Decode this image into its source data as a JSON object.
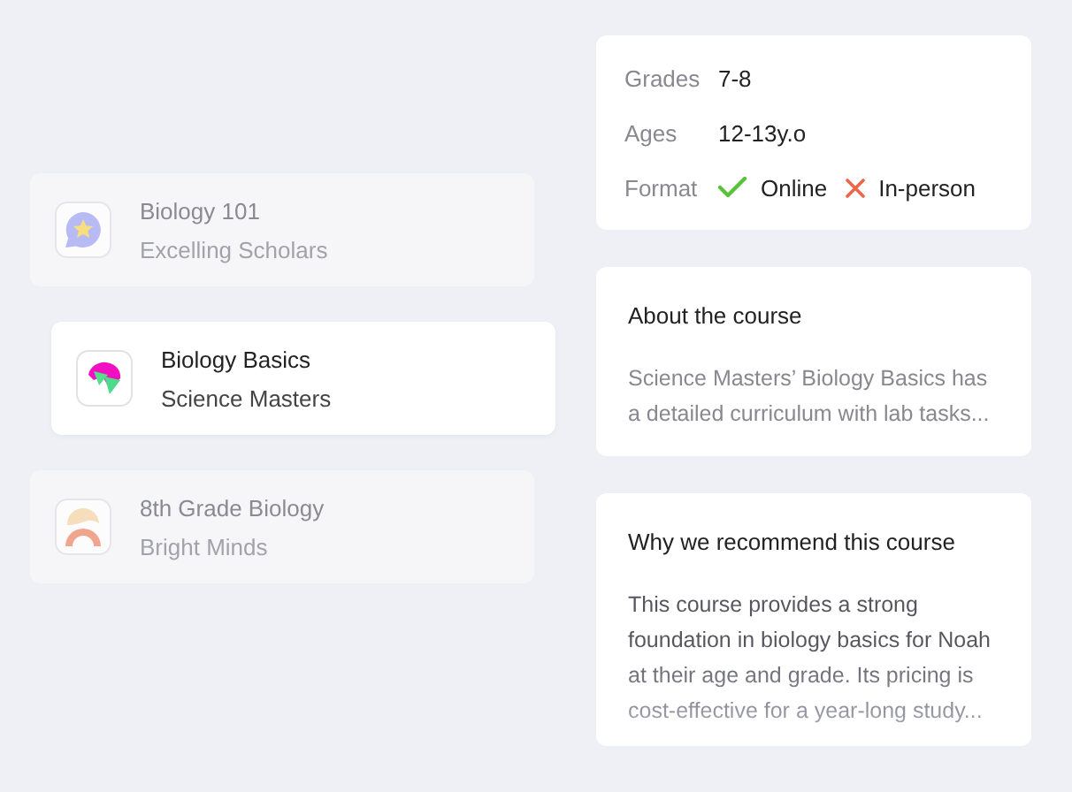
{
  "courses": [
    {
      "title": "Biology 101",
      "provider": "Excelling Scholars",
      "selected": false
    },
    {
      "title": "Biology Basics",
      "provider": "Science Masters",
      "selected": true
    },
    {
      "title": "8th Grade Biology",
      "provider": "Bright Minds",
      "selected": false
    }
  ],
  "details": {
    "rows": [
      {
        "label": "Grades",
        "value": "7-8"
      },
      {
        "label": "Ages",
        "value": "12-13y.o"
      }
    ],
    "format": {
      "label": "Format",
      "options": [
        {
          "name": "Online",
          "available": true
        },
        {
          "name": "In-person",
          "available": false
        }
      ]
    }
  },
  "sections": [
    {
      "heading": "About the course",
      "text": "Science Masters’ Biology Basics has a detailed curriculum with lab tasks..."
    },
    {
      "heading": "Why we recommend this course",
      "text": "This course provides a strong foundation in biology basics for Noah at their age and grade. Its pricing is cost-effective for a year-long study..."
    }
  ]
}
